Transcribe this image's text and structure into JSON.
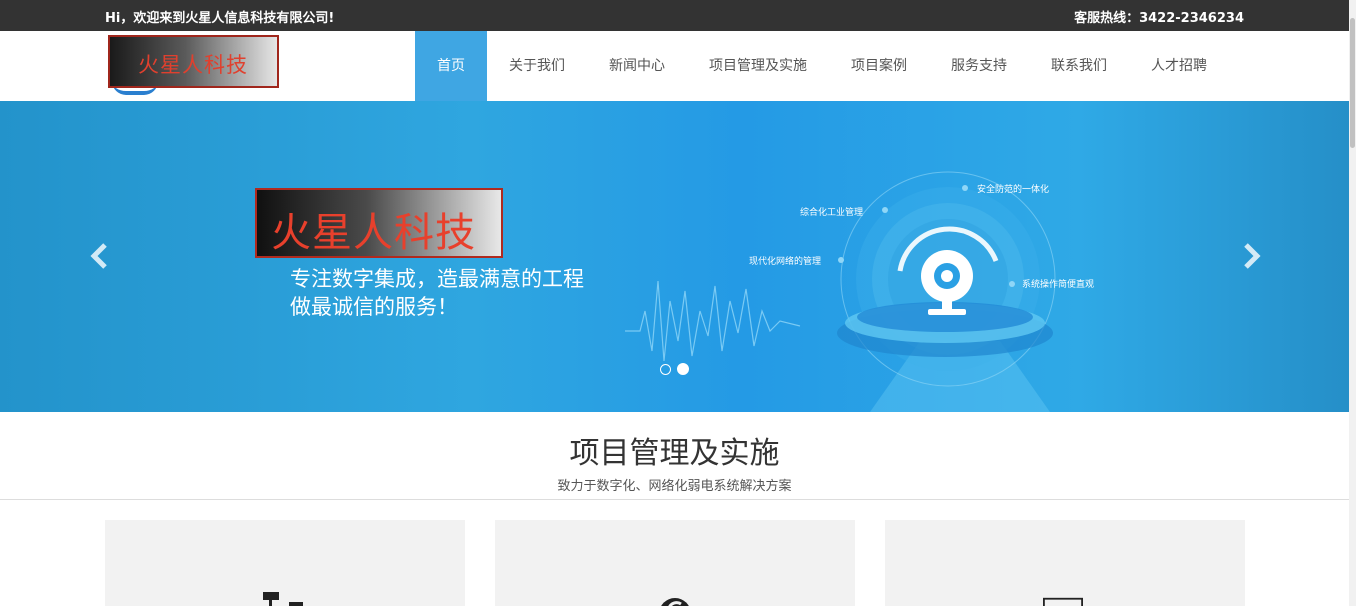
{
  "topbar": {
    "greeting": "Hi，欢迎来到火星人信息科技有限公司!",
    "hotline": "客服热线：3422-2346234"
  },
  "header": {
    "logo_text": "火星人科技",
    "nav": [
      {
        "label": "首页",
        "active": true
      },
      {
        "label": "关于我们"
      },
      {
        "label": "新闻中心"
      },
      {
        "label": "项目管理及实施"
      },
      {
        "label": "项目案例"
      },
      {
        "label": "服务支持"
      },
      {
        "label": "联系我们"
      },
      {
        "label": "人才招聘"
      }
    ]
  },
  "banner": {
    "logo_text": "火星人科技",
    "slogan_line1": "专注数字集成，造最满意的工程",
    "slogan_line2": "做最诚信的服务！",
    "features": [
      "安全防范的一体化",
      "综合化工业管理",
      "现代化网络的管理",
      "系统操作简便直观"
    ],
    "slides": 2,
    "active_slide": 2
  },
  "section": {
    "title": "项目管理及实施",
    "subtitle": "致力于数字化、网络化弱电系统解决方案"
  },
  "colors": {
    "topbar_bg": "#333333",
    "nav_active": "#3fa6e3",
    "banner_blue": "#2fa6e0",
    "card_bg": "#f2f2f2"
  },
  "icons": [
    "chevron-left-icon",
    "chevron-right-icon",
    "camera-icon",
    "network-icon",
    "circle-icon",
    "monitor-icon"
  ]
}
